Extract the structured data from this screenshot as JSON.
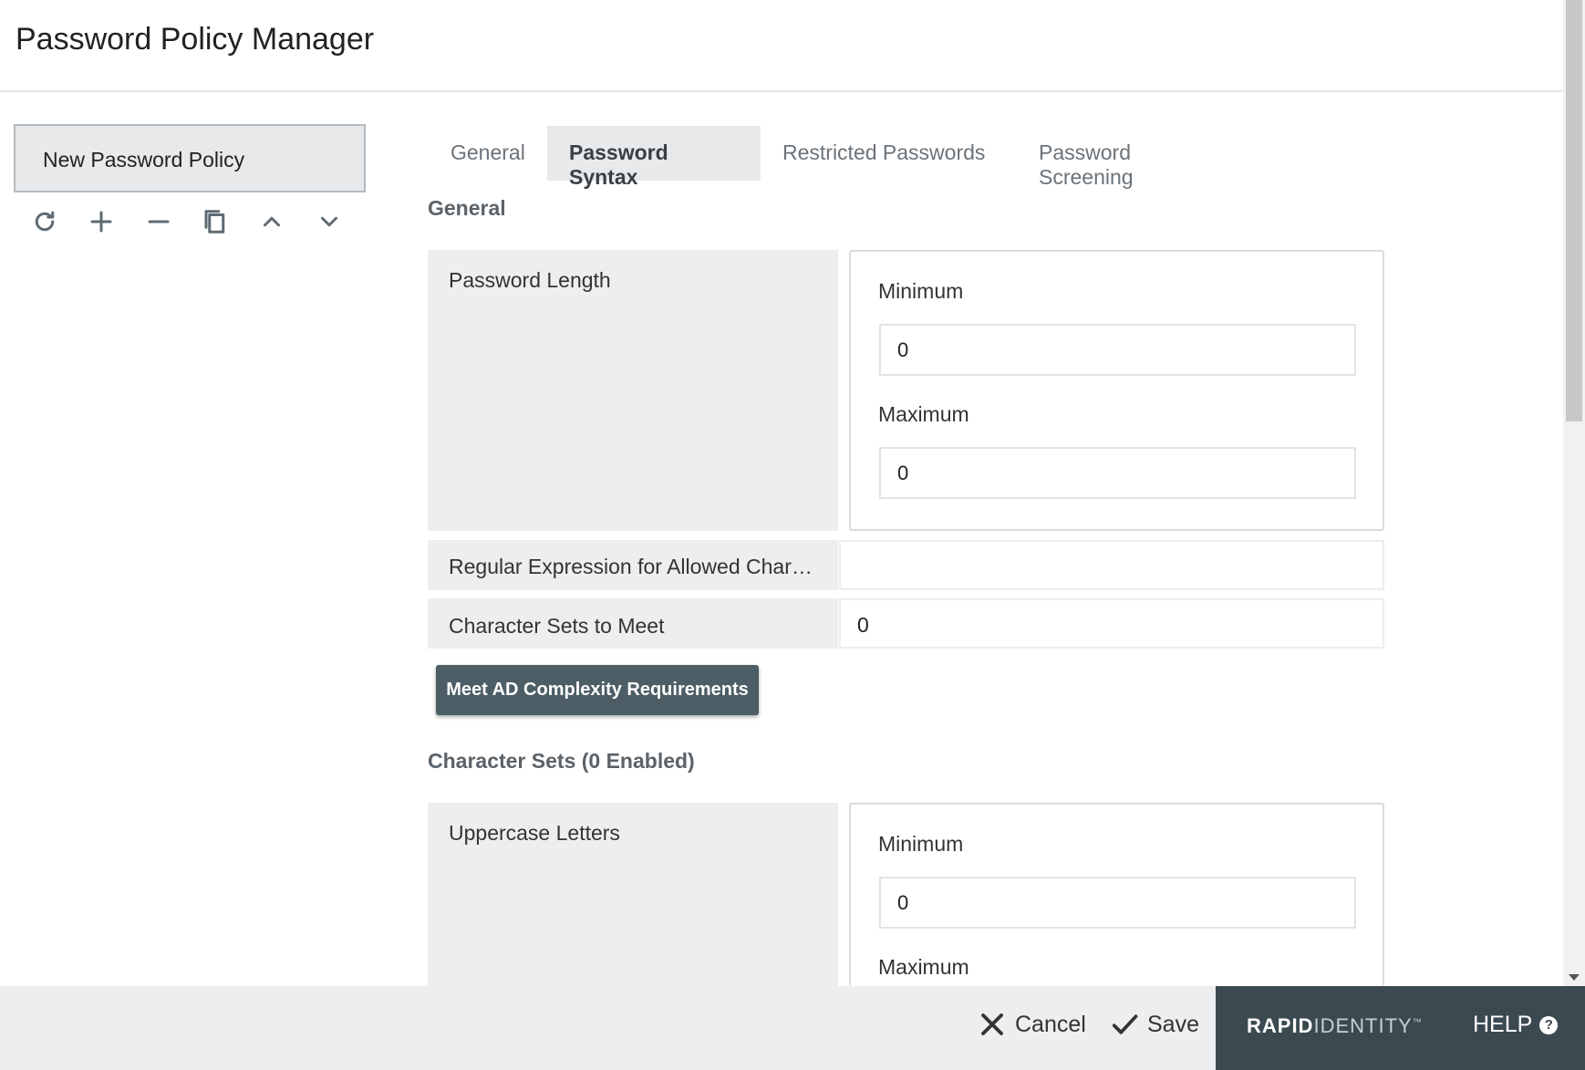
{
  "header": {
    "title": "Password Policy Manager"
  },
  "sidebar": {
    "policies": [
      {
        "label": "New Password Policy"
      }
    ],
    "tools": [
      {
        "icon": "refresh-icon"
      },
      {
        "icon": "plus-icon"
      },
      {
        "icon": "minus-icon"
      },
      {
        "icon": "copy-icon"
      },
      {
        "icon": "chevron-up-icon"
      },
      {
        "icon": "chevron-down-icon"
      }
    ]
  },
  "tabs": [
    {
      "label": "General",
      "active": false
    },
    {
      "label": "Password Syntax",
      "active": true
    },
    {
      "label": "Restricted Passwords",
      "active": false
    },
    {
      "label": "Password Screening",
      "active": false
    }
  ],
  "general_section": {
    "title": "General",
    "password_length": {
      "label": "Password Length",
      "minimum_label": "Minimum",
      "minimum_value": "0",
      "maximum_label": "Maximum",
      "maximum_value": "0"
    },
    "regex": {
      "label": "Regular Expression for Allowed Char…",
      "value": ""
    },
    "char_sets_to_meet": {
      "label": "Character Sets to Meet",
      "value": "0"
    },
    "ad_button_label": "Meet AD Complexity Requirements"
  },
  "character_sets_section": {
    "title": "Character Sets (0 Enabled)",
    "uppercase": {
      "label": "Uppercase Letters",
      "minimum_label": "Minimum",
      "minimum_value": "0",
      "maximum_label": "Maximum"
    }
  },
  "footer": {
    "cancel_label": "Cancel",
    "save_label": "Save",
    "brand_bold": "RAPID",
    "brand_light": "IDENTITY",
    "brand_tm": "™",
    "help_label": "HELP",
    "help_icon_glyph": "?"
  }
}
